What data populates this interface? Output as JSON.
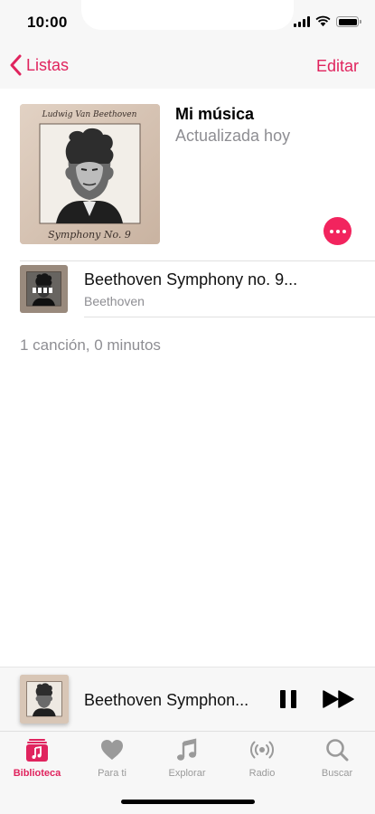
{
  "status": {
    "time": "10:00"
  },
  "nav": {
    "back_label": "Listas",
    "edit_label": "Editar"
  },
  "playlist": {
    "title": "Mi música",
    "subtitle": "Actualizada hoy",
    "cover_line1": "Ludwig Van Beethoven",
    "cover_line2": "Symphony No. 9"
  },
  "tracks": [
    {
      "title": "Beethoven Symphony no. 9...",
      "artist": "Beethoven",
      "playing": true
    }
  ],
  "summary": "1 canción, 0 minutos",
  "mini_player": {
    "title": "Beethoven Symphon...",
    "state": "playing"
  },
  "tabs": [
    {
      "label": "Biblioteca",
      "icon": "library-icon",
      "active": true
    },
    {
      "label": "Para ti",
      "icon": "heart-icon",
      "active": false
    },
    {
      "label": "Explorar",
      "icon": "music-note-icon",
      "active": false
    },
    {
      "label": "Radio",
      "icon": "radio-icon",
      "active": false
    },
    {
      "label": "Buscar",
      "icon": "search-icon",
      "active": false
    }
  ],
  "colors": {
    "accent": "#e0245e",
    "more_button": "#f2245e",
    "inactive_tab": "#9a9a9a"
  }
}
